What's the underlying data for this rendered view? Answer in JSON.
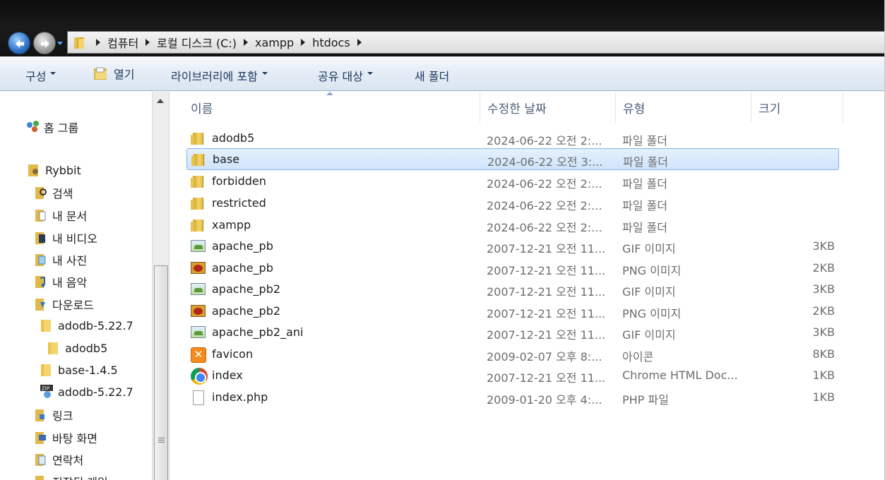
{
  "address": {
    "crumbs": [
      "컴퓨터",
      "로컬 디스크 (C:)",
      "xampp",
      "htdocs"
    ]
  },
  "toolbar": {
    "organize": "구성",
    "open": "열기",
    "include_library": "라이브러리에 포함",
    "share": "공유 대상",
    "new_folder": "새 폴더"
  },
  "nav": {
    "homegroup": "홈 그룹",
    "user": "Rybbit",
    "items": [
      "검색",
      "내 문서",
      "내 비디오",
      "내 사진",
      "내 음악",
      "다운로드",
      "adodb-5.22.7",
      "adodb5",
      "base-1.4.5",
      "adodb-5.22.7",
      "링크",
      "바탕 화면",
      "연락처",
      "저장된 게임"
    ]
  },
  "columns": {
    "name": "이름",
    "date": "수정한 날짜",
    "type": "유형",
    "size": "크기"
  },
  "files": [
    {
      "icon": "folder-icon",
      "name": "adodb5",
      "date": "2024-06-22 오전 2:...",
      "type": "파일 폴더",
      "size": ""
    },
    {
      "icon": "folder-icon",
      "name": "base",
      "date": "2024-06-22 오전 3:...",
      "type": "파일 폴더",
      "size": "",
      "selected": true
    },
    {
      "icon": "folder-icon",
      "name": "forbidden",
      "date": "2024-06-22 오전 2:...",
      "type": "파일 폴더",
      "size": ""
    },
    {
      "icon": "folder-icon",
      "name": "restricted",
      "date": "2024-06-22 오전 2:...",
      "type": "파일 폴더",
      "size": ""
    },
    {
      "icon": "folder-icon",
      "name": "xampp",
      "date": "2024-06-22 오전 2:...",
      "type": "파일 폴더",
      "size": ""
    },
    {
      "icon": "gif-image-icon",
      "name": "apache_pb",
      "date": "2007-12-21 오전 11...",
      "type": "GIF 이미지",
      "size": "3KB"
    },
    {
      "icon": "png-image-icon",
      "name": "apache_pb",
      "date": "2007-12-21 오전 11...",
      "type": "PNG 이미지",
      "size": "2KB"
    },
    {
      "icon": "gif-image-icon",
      "name": "apache_pb2",
      "date": "2007-12-21 오전 11...",
      "type": "GIF 이미지",
      "size": "3KB"
    },
    {
      "icon": "png-image-icon",
      "name": "apache_pb2",
      "date": "2007-12-21 오전 11...",
      "type": "PNG 이미지",
      "size": "2KB"
    },
    {
      "icon": "gif-image-icon",
      "name": "apache_pb2_ani",
      "date": "2007-12-21 오전 11...",
      "type": "GIF 이미지",
      "size": "3KB"
    },
    {
      "icon": "xampp-favicon-icon",
      "name": "favicon",
      "date": "2009-02-07 오후 8:...",
      "type": "아이콘",
      "size": "8KB"
    },
    {
      "icon": "chrome-html-icon",
      "name": "index",
      "date": "2007-12-21 오전 11...",
      "type": "Chrome HTML Doc...",
      "size": "1KB"
    },
    {
      "icon": "php-file-icon",
      "name": "index.php",
      "date": "2009-01-20 오후 4:...",
      "type": "PHP 파일",
      "size": "1KB"
    }
  ]
}
